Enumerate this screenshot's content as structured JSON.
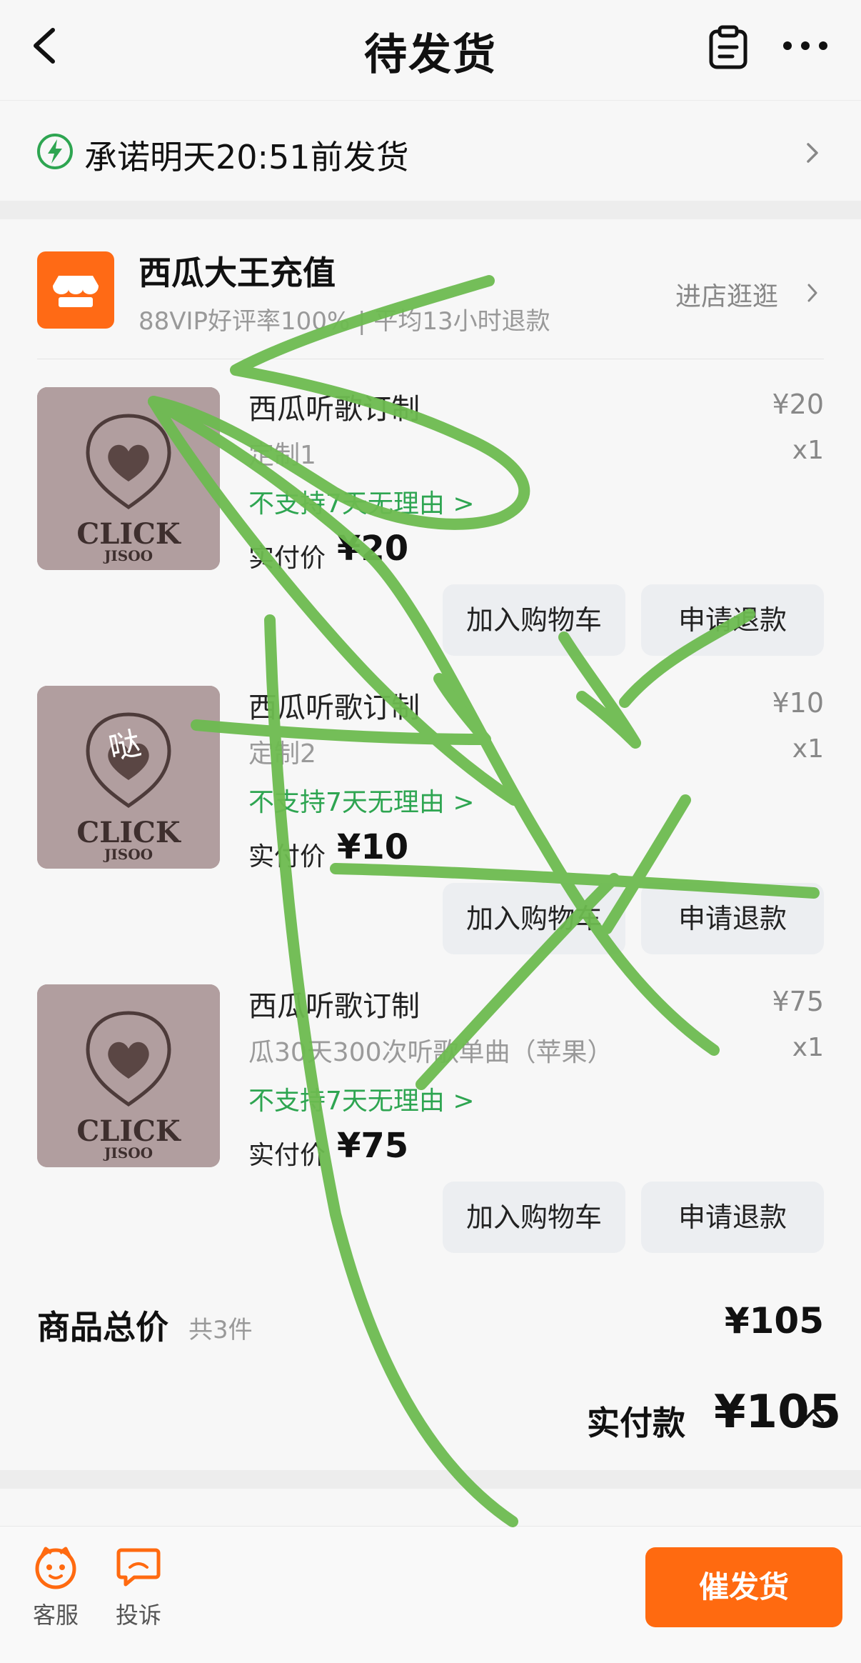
{
  "header": {
    "title": "待发货"
  },
  "promise": {
    "text": "承诺明天20:51前发货"
  },
  "store": {
    "name": "西瓜大王充值",
    "subtitle": "88VIP好评率100% | 平均13小时退款",
    "visit_label": "进店逛逛"
  },
  "products": [
    {
      "title": "西瓜听歌订制",
      "spec": "定制1",
      "policy": "不支持7天无理由 >",
      "paid_label": "实付价",
      "paid_value": "¥20",
      "price": "¥20",
      "qty": "x1",
      "add_cart_label": "加入购物车",
      "refund_label": "申请退款",
      "image_text": "CLICK",
      "image_subtext": "JISOO"
    },
    {
      "title": "西瓜听歌订制",
      "spec": "定制2",
      "policy": "不支持7天无理由 >",
      "paid_label": "实付价",
      "paid_value": "¥10",
      "price": "¥10",
      "qty": "x1",
      "add_cart_label": "加入购物车",
      "refund_label": "申请退款",
      "image_text": "CLICK",
      "image_subtext": "JISOO",
      "image_overlay": "哒"
    },
    {
      "title": "西瓜听歌订制",
      "spec": "瓜30天300次听歌单曲（苹果）",
      "policy": "不支持7天无理由 >",
      "paid_label": "实付价",
      "paid_value": "¥75",
      "price": "¥75",
      "qty": "x1",
      "add_cart_label": "加入购物车",
      "refund_label": "申请退款",
      "image_text": "CLICK",
      "image_subtext": "JISOO"
    }
  ],
  "totals": {
    "goods_total_label": "商品总价",
    "goods_count": "共3件",
    "goods_total_price": "¥105",
    "paid_total_label": "实付款",
    "paid_total_value": "¥105"
  },
  "bottom_bar": {
    "service_label": "客服",
    "complaint_label": "投诉",
    "urge_label": "催发货"
  },
  "colors": {
    "accent_orange": "#ff6a10",
    "policy_green": "#2ea551",
    "scribble_green": "#6dbb50"
  }
}
